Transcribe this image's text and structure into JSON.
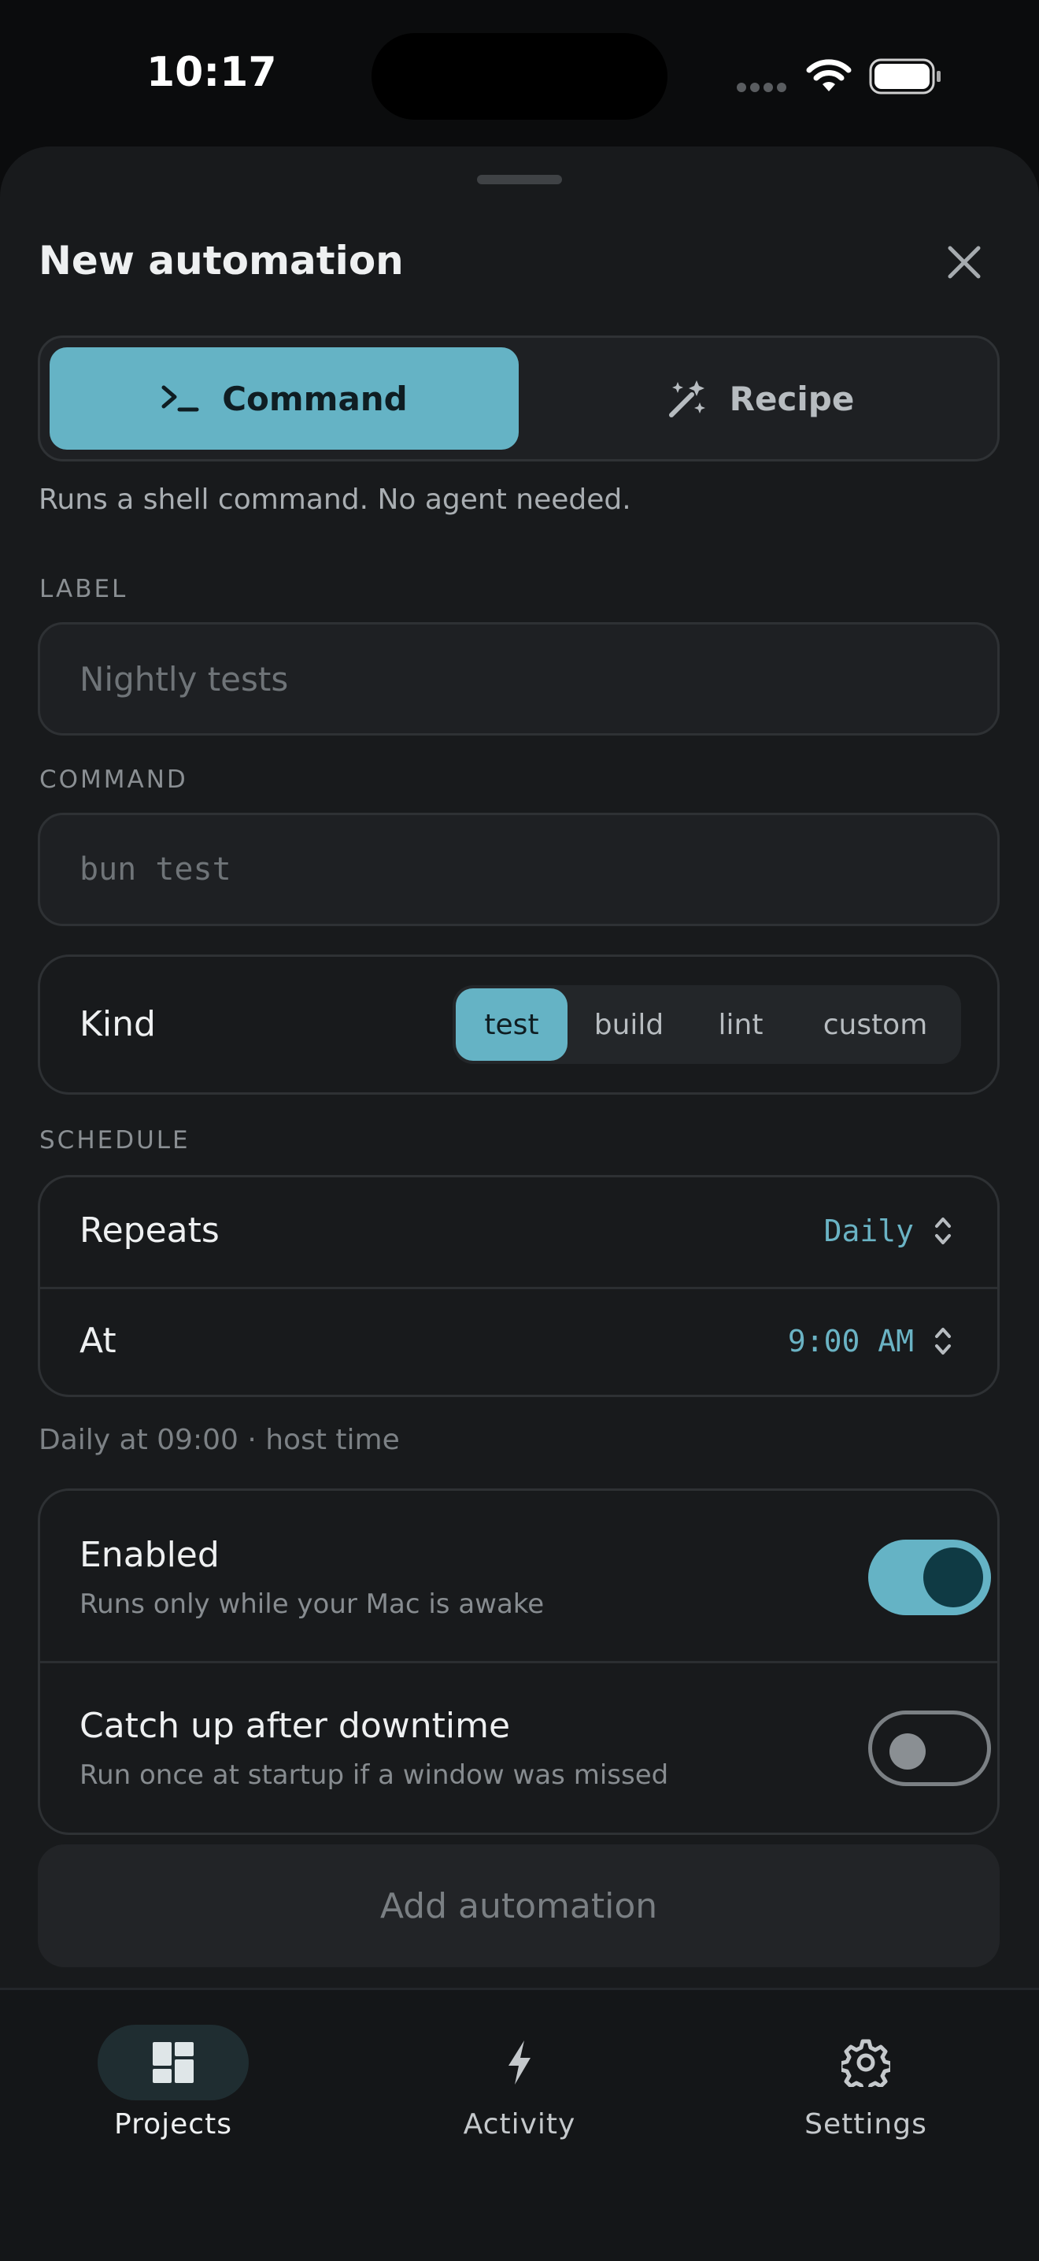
{
  "status_bar": {
    "time": "10:17"
  },
  "sheet": {
    "title": "New automation",
    "mode": {
      "options": [
        {
          "label": "Command",
          "icon": "terminal-icon",
          "selected": true
        },
        {
          "label": "Recipe",
          "icon": "magic-wand-icon",
          "selected": false
        }
      ],
      "description": "Runs a shell command. No agent needed."
    },
    "label_field": {
      "section": "LABEL",
      "value": "",
      "placeholder": "Nightly tests"
    },
    "command_field": {
      "section": "COMMAND",
      "value": "",
      "placeholder": "bun test"
    },
    "kind": {
      "label": "Kind",
      "options": [
        "test",
        "build",
        "lint",
        "custom"
      ],
      "selected": "test"
    },
    "schedule": {
      "section": "SCHEDULE",
      "repeats_label": "Repeats",
      "repeats_value": "Daily",
      "at_label": "At",
      "at_value": "9:00 AM",
      "summary": "Daily at 09:00 · host time"
    },
    "enabled": {
      "label": "Enabled",
      "sublabel": "Runs only while your Mac is awake",
      "on": true
    },
    "catch_up": {
      "label": "Catch up after downtime",
      "sublabel": "Run once at startup if a window was missed",
      "on": false
    },
    "submit_label": "Add automation"
  },
  "tabbar": {
    "items": [
      {
        "label": "Projects",
        "icon": "grid-icon",
        "active": true
      },
      {
        "label": "Activity",
        "icon": "bolt-icon",
        "active": false
      },
      {
        "label": "Settings",
        "icon": "gear-icon",
        "active": false
      }
    ]
  },
  "colors": {
    "accent": "#65b3c5",
    "background": "#181a1c",
    "surface": "#1e2023"
  }
}
